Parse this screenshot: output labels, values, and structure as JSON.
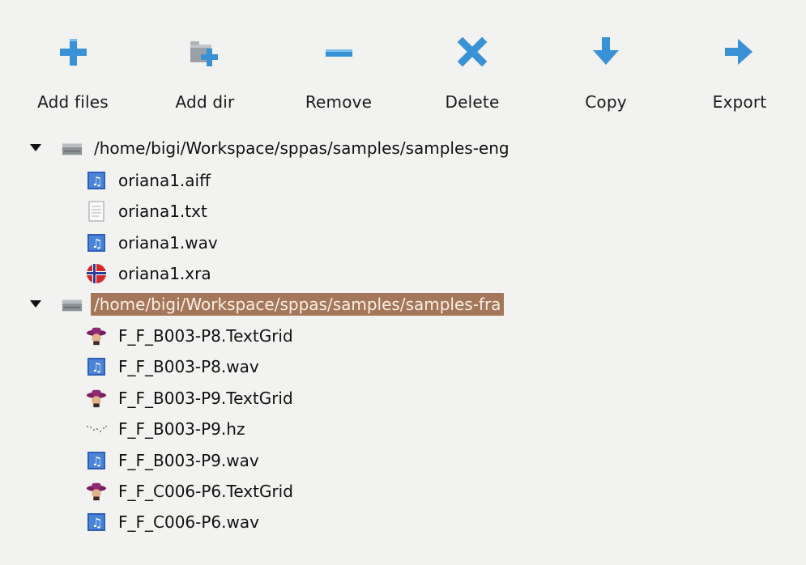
{
  "toolbar": {
    "add_files": "Add files",
    "add_dir": "Add dir",
    "remove": "Remove",
    "delete": "Delete",
    "copy": "Copy",
    "export": "Export"
  },
  "colors": {
    "accent_blue": "#3a92d6",
    "selection": "#a5775a"
  },
  "tree": {
    "dir1": {
      "path": "/home/bigi/Workspace/sppas/samples/samples-eng",
      "files": [
        "oriana1.aiff",
        "oriana1.txt",
        "oriana1.wav",
        "oriana1.xra"
      ]
    },
    "dir2": {
      "path": "/home/bigi/Workspace/sppas/samples/samples-fra",
      "selected": true,
      "files": [
        "F_F_B003-P8.TextGrid",
        "F_F_B003-P8.wav",
        "F_F_B003-P9.TextGrid",
        "F_F_B003-P9.hz",
        "F_F_B003-P9.wav",
        "F_F_C006-P6.TextGrid",
        "F_F_C006-P6.wav"
      ]
    }
  }
}
